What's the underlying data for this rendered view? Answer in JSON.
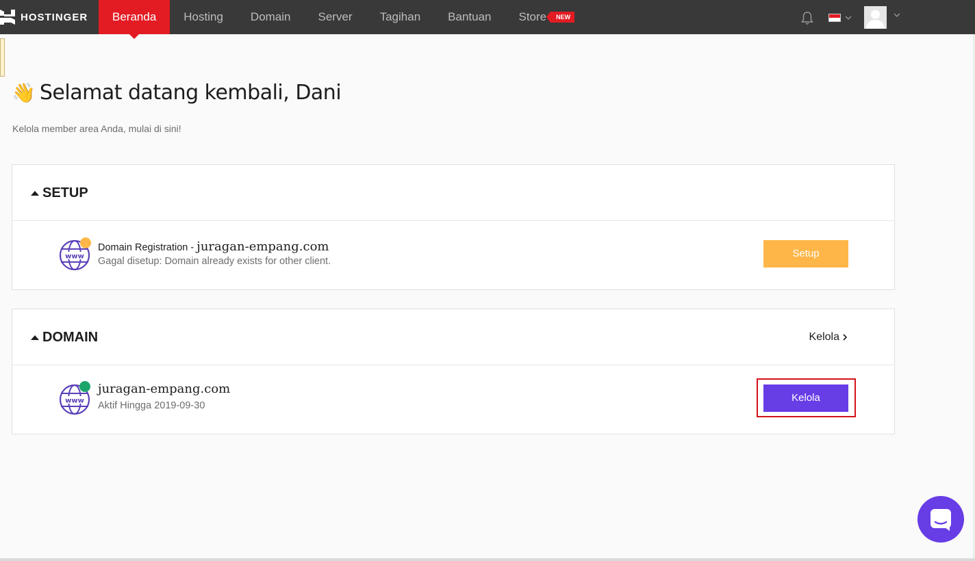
{
  "brand": {
    "name": "HOSTINGER"
  },
  "nav": {
    "items": [
      {
        "label": "Beranda",
        "active": true
      },
      {
        "label": "Hosting",
        "active": false
      },
      {
        "label": "Domain",
        "active": false
      },
      {
        "label": "Server",
        "active": false
      },
      {
        "label": "Tagihan",
        "active": false
      },
      {
        "label": "Bantuan",
        "active": false
      },
      {
        "label": "Store",
        "active": false,
        "badge": "NEW"
      }
    ],
    "icons": [
      "bell-icon",
      "flag-icon",
      "avatar-icon"
    ]
  },
  "welcome": {
    "emoji": "👋",
    "title": "Selamat datang kembali, Dani",
    "subtitle": "Kelola member area Anda, mulai di sini!"
  },
  "setup": {
    "header": "SETUP",
    "item": {
      "title_prefix": "Domain Registration - ",
      "domain": "juragan-empang.com",
      "status": "Gagal disetup: Domain already exists for other client.",
      "button": "Setup",
      "status_color": "#ffb648"
    }
  },
  "domain": {
    "header": "DOMAIN",
    "header_link": "Kelola",
    "item": {
      "domain": "juragan-empang.com",
      "status": "Aktif Hingga 2019-09-30",
      "button": "Kelola",
      "status_color": "#1ba56b"
    }
  },
  "colors": {
    "topbar": "#393939",
    "active_nav": "#e31b23",
    "primary": "#673de6",
    "warning": "#ffb648",
    "success": "#1ba56b",
    "highlight": "#d4111a"
  }
}
